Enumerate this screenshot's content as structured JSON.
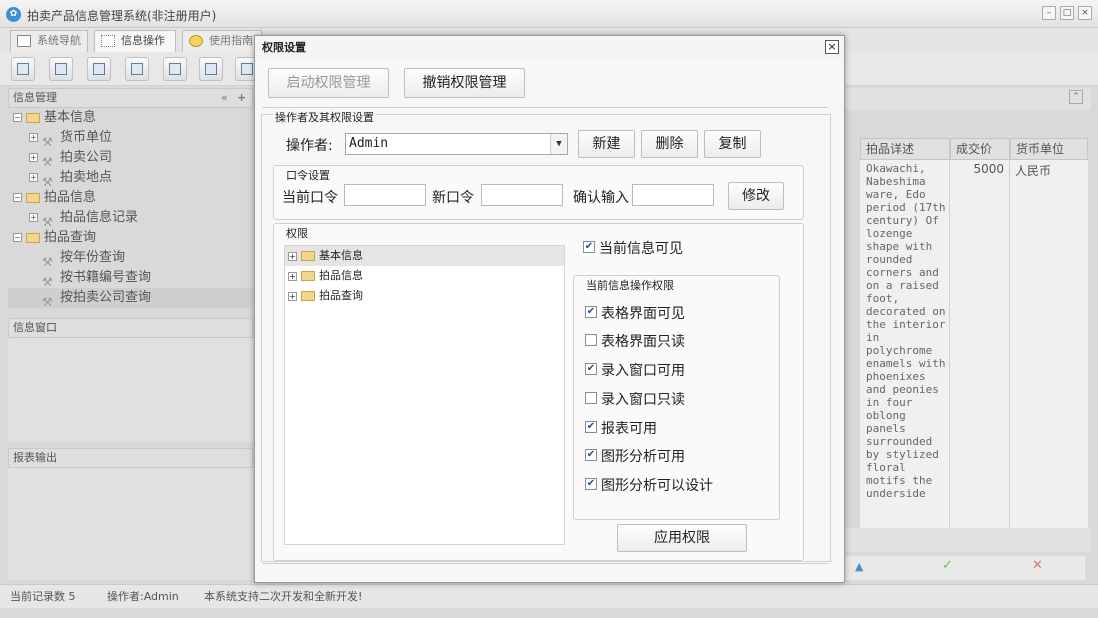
{
  "app": {
    "title": "拍卖产品信息管理系统(非注册用户)",
    "window_buttons": [
      "–",
      "□",
      "×"
    ]
  },
  "tabs": [
    {
      "label": "系统导航",
      "icon": "monitor-icon"
    },
    {
      "label": "信息操作",
      "icon": "grid-icon"
    },
    {
      "label": "使用指南",
      "icon": "clock-icon"
    }
  ],
  "sidebar": {
    "panel_title": "信息管理",
    "collapse_icon": "«",
    "add_icon": "+",
    "tree": [
      {
        "label": "基本信息",
        "level": 0,
        "type": "folder"
      },
      {
        "label": "货币单位",
        "level": 1,
        "type": "leaf"
      },
      {
        "label": "拍卖公司",
        "level": 1,
        "type": "leaf"
      },
      {
        "label": "拍卖地点",
        "level": 1,
        "type": "leaf"
      },
      {
        "label": "拍品信息",
        "level": 0,
        "type": "folder"
      },
      {
        "label": "拍品信息记录",
        "level": 1,
        "type": "leaf"
      },
      {
        "label": "拍品查询",
        "level": 0,
        "type": "folder"
      },
      {
        "label": "按年份查询",
        "level": 1,
        "type": "leaf"
      },
      {
        "label": "按书籍编号查询",
        "level": 1,
        "type": "leaf"
      },
      {
        "label": "按拍卖公司查询",
        "level": 1,
        "type": "leaf",
        "selected": true
      }
    ],
    "info_window_title": "信息窗口",
    "report_title": "报表输出"
  },
  "grid": {
    "columns": [
      "拍品详述",
      "成交价",
      "货币单位"
    ],
    "row": {
      "detail": "Okawachi, Nabeshima ware, Edo period (17th century) Of lozenge shape with rounded corners and on a raised foot, decorated on the interior in polychrome enamels with phoenixes and peonies in four oblong panels surrounded by stylized floral motifs the underside",
      "price": "5000",
      "currency": "人民币"
    },
    "footer_icons": [
      "▲",
      "✓",
      "✕"
    ],
    "collapse_icon": "⌃"
  },
  "status": {
    "record_count": "当前记录数 5",
    "operator": "操作者:Admin",
    "message": "本系统支持二次开发和全新开发!"
  },
  "dialog": {
    "title": "权限设置",
    "close": "×",
    "start_btn": "启动权限管理",
    "revoke_btn": "撤销权限管理",
    "operator_group": "操作者及其权限设置",
    "operator_label": "操作者:",
    "operator_value": "Admin",
    "new_btn": "新建",
    "delete_btn": "删除",
    "copy_btn": "复制",
    "password_group": "口令设置",
    "current_pw": "当前口令",
    "new_pw": "新口令",
    "confirm_pw": "确认输入",
    "modify_btn": "修改",
    "perm_group": "权限",
    "perm_tree": [
      "基本信息",
      "拍品信息",
      "拍品查询"
    ],
    "visible_label": "当前信息可见",
    "visible_checked": true,
    "ops_group": "当前信息操作权限",
    "ops": [
      {
        "label": "表格界面可见",
        "checked": true
      },
      {
        "label": "表格界面只读",
        "checked": false
      },
      {
        "label": "录入窗口可用",
        "checked": true
      },
      {
        "label": "录入窗口只读",
        "checked": false
      },
      {
        "label": "报表可用",
        "checked": true
      },
      {
        "label": "图形分析可用",
        "checked": true
      },
      {
        "label": "图形分析可以设计",
        "checked": true
      }
    ],
    "apply_btn": "应用权限"
  }
}
